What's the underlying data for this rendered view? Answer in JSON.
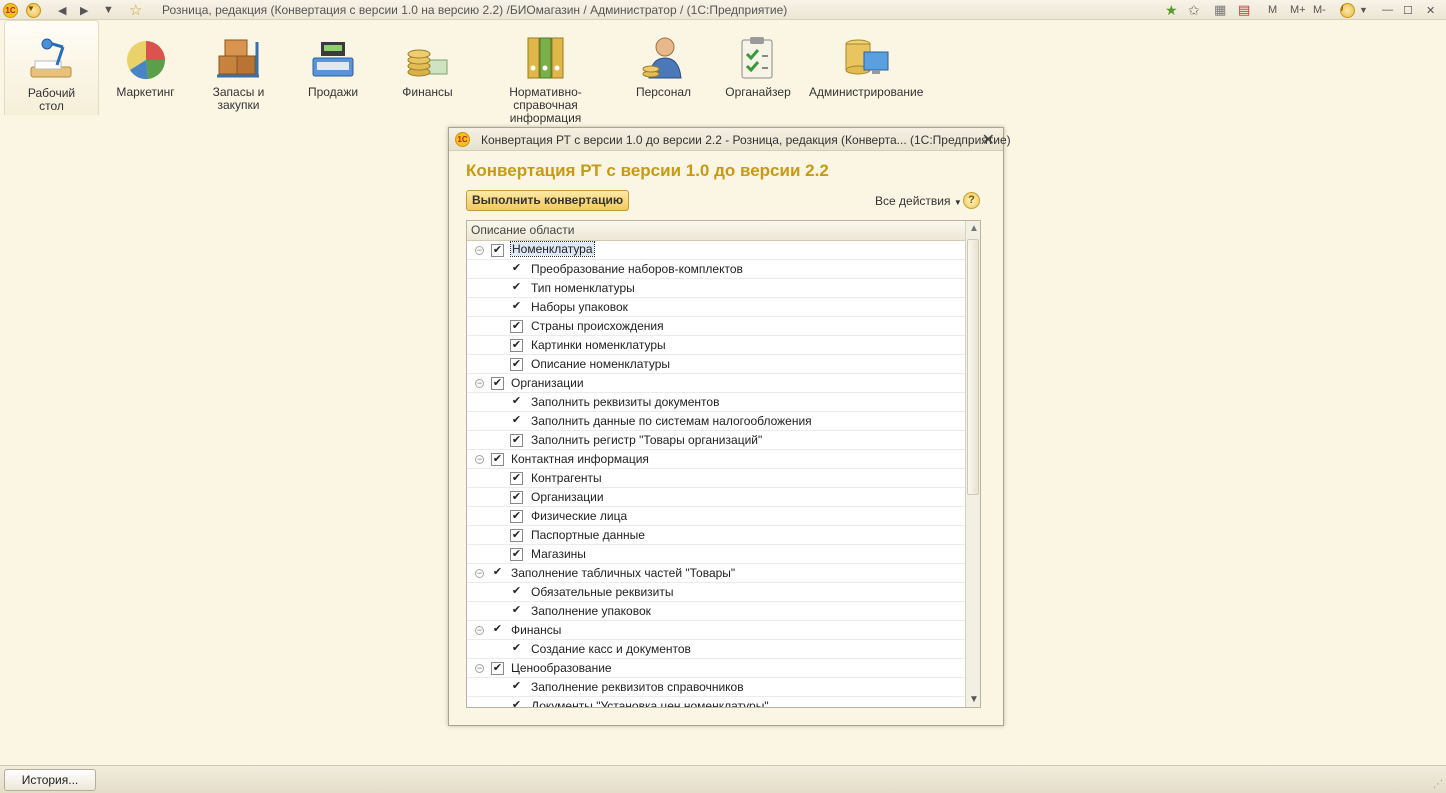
{
  "titlebar": {
    "title": "Розница, редакция (Конвертация с версии 1.0 на версию 2.2) /БИОмагазин / Администратор /  (1С:Предприятие)",
    "logo": "1С",
    "memory": [
      "M",
      "M+",
      "M-"
    ],
    "info_symbol": "i",
    "controls": {
      "minimize": "—",
      "maximize": "☐",
      "close": "✕"
    }
  },
  "sections": [
    {
      "label": "Рабочий\nстол",
      "icon": "desk-lamp-icon"
    },
    {
      "label": "Маркетинг",
      "icon": "pie-chart-icon"
    },
    {
      "label": "Запасы и\nзакупки",
      "icon": "boxes-cart-icon"
    },
    {
      "label": "Продажи",
      "icon": "cash-register-icon"
    },
    {
      "label": "Финансы",
      "icon": "coins-icon"
    },
    {
      "label": "Нормативно-справочная\nинформация",
      "icon": "binders-icon"
    },
    {
      "label": "Персонал",
      "icon": "person-icon"
    },
    {
      "label": "Органайзер",
      "icon": "clipboard-icon"
    },
    {
      "label": "Администрирование",
      "icon": "database-computer-icon"
    }
  ],
  "dialog": {
    "window_title": "Конвертация РТ с версии 1.0 до версии 2.2 - Розница, редакция (Конверта...  (1С:Предприятие)",
    "form_title": "Конвертация РТ с версии 1.0 до версии 2.2",
    "run_button": "Выполнить конвертацию",
    "all_actions": "Все действия",
    "help": "?",
    "close": "✕",
    "tree": {
      "column_header": "Описание области",
      "rows": [
        {
          "level": 0,
          "text": "Номенклатура",
          "box": true,
          "checked": true,
          "selected": true
        },
        {
          "level": 1,
          "text": "Преобразование наборов-комплектов",
          "box": false,
          "checked": true
        },
        {
          "level": 1,
          "text": "Тип номенклатуры",
          "box": false,
          "checked": true
        },
        {
          "level": 1,
          "text": "Наборы упаковок",
          "box": false,
          "checked": true
        },
        {
          "level": 1,
          "text": "Страны происхождения",
          "box": true,
          "checked": true
        },
        {
          "level": 1,
          "text": "Картинки номенклатуры",
          "box": true,
          "checked": true
        },
        {
          "level": 1,
          "text": "Описание номенклатуры",
          "box": true,
          "checked": true
        },
        {
          "level": 0,
          "text": "Организации",
          "box": true,
          "checked": true
        },
        {
          "level": 1,
          "text": "Заполнить реквизиты документов",
          "box": false,
          "checked": true
        },
        {
          "level": 1,
          "text": "Заполнить данные по системам налогообложения",
          "box": false,
          "checked": true
        },
        {
          "level": 1,
          "text": "Заполнить регистр \"Товары организаций\"",
          "box": true,
          "checked": true
        },
        {
          "level": 0,
          "text": "Контактная информация",
          "box": true,
          "checked": true
        },
        {
          "level": 1,
          "text": "Контрагенты",
          "box": true,
          "checked": true
        },
        {
          "level": 1,
          "text": "Организации",
          "box": true,
          "checked": true
        },
        {
          "level": 1,
          "text": "Физические лица",
          "box": true,
          "checked": true
        },
        {
          "level": 1,
          "text": "Паспортные данные",
          "box": true,
          "checked": true
        },
        {
          "level": 1,
          "text": "Магазины",
          "box": true,
          "checked": true
        },
        {
          "level": 0,
          "text": "Заполнение табличных частей \"Товары\"",
          "box": false,
          "checked": true
        },
        {
          "level": 1,
          "text": "Обязательные реквизиты",
          "box": false,
          "checked": true
        },
        {
          "level": 1,
          "text": "Заполнение упаковок",
          "box": false,
          "checked": true
        },
        {
          "level": 0,
          "text": "Финансы",
          "box": false,
          "checked": true
        },
        {
          "level": 1,
          "text": "Создание касс и документов",
          "box": false,
          "checked": true
        },
        {
          "level": 0,
          "text": "Ценообразование",
          "box": true,
          "checked": true
        },
        {
          "level": 1,
          "text": "Заполнение реквизитов справочников",
          "box": false,
          "checked": true
        },
        {
          "level": 1,
          "text": "Документы \"Установка цен номенклатуры\"",
          "box": false,
          "checked": true
        }
      ]
    }
  },
  "footer": {
    "history_button": "История..."
  }
}
